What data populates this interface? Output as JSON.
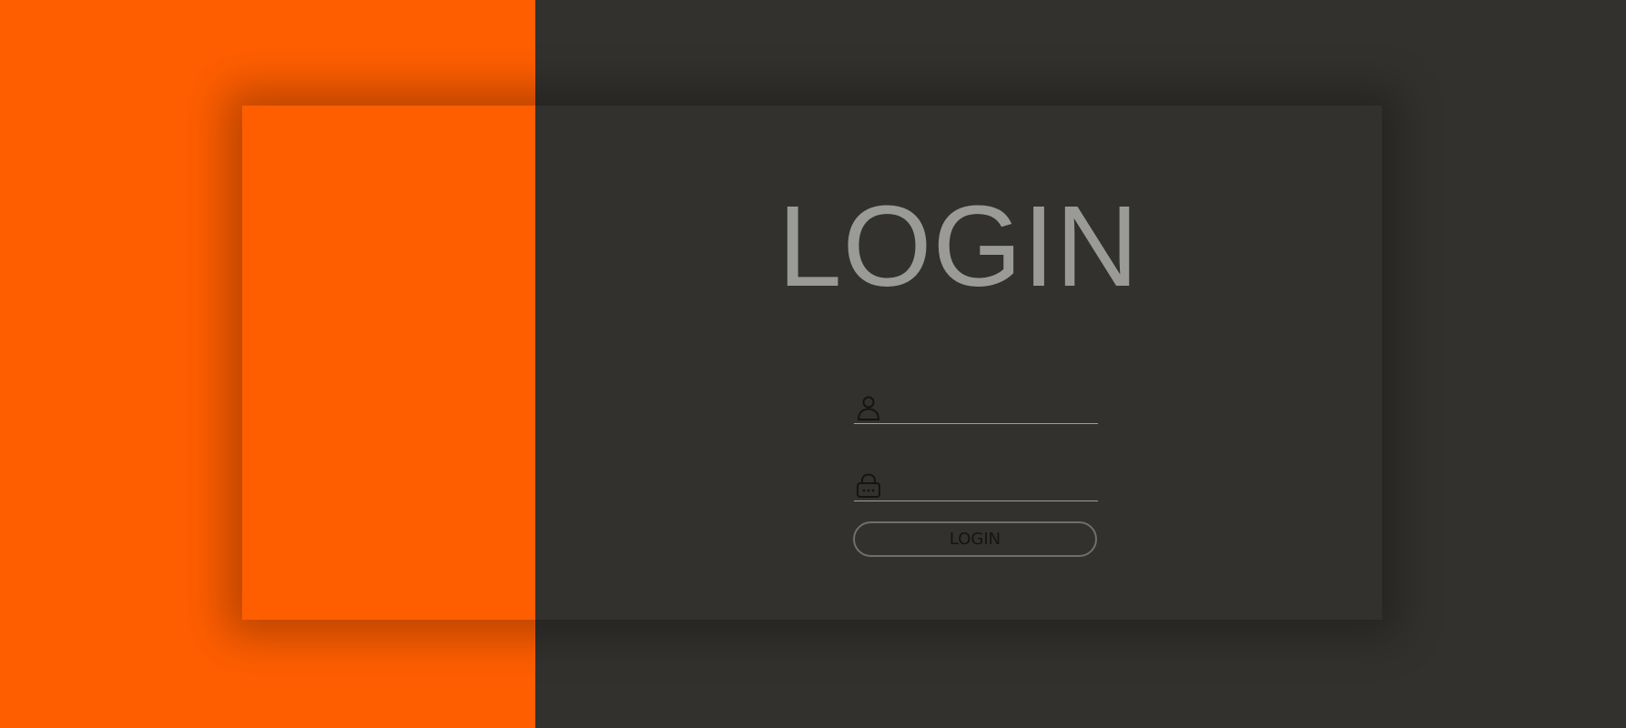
{
  "title": "LOGIN",
  "form": {
    "username": {
      "icon": "user-icon",
      "value": "",
      "placeholder": ""
    },
    "password": {
      "icon": "lock-icon",
      "value": "",
      "placeholder": ""
    },
    "submit_label": "LOGIN"
  },
  "colors": {
    "accent": "#ff5e00",
    "background": "#32312e",
    "title_text": "#9a9a97"
  }
}
